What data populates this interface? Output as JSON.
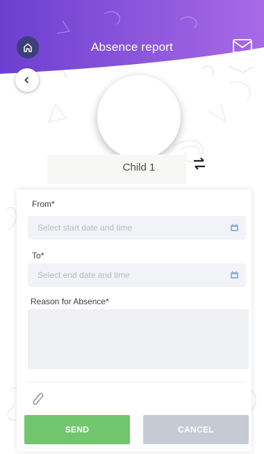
{
  "header": {
    "title": "Absence report",
    "gradient_left": "#6c3fd0",
    "gradient_right": "#a86ae6",
    "home_icon": "home-icon",
    "mail_icon": "mail-icon",
    "back_icon": "chevron-left-icon"
  },
  "profile": {
    "child_name": "Child 1",
    "switch_icon": "swap-arrows-icon"
  },
  "form": {
    "from_label": "From",
    "from_placeholder": "Select start date and time",
    "to_label": "To",
    "to_placeholder": "Select end date and time",
    "reason_label": "Reason for Absence",
    "required_mark": "*",
    "attach_icon": "paperclip-icon",
    "calendar_icon": "calendar-icon",
    "send_label": "SEND",
    "cancel_label": "CANCEL",
    "send_color": "#71c66e",
    "cancel_color": "#c5cad3",
    "field_placeholder_color": "#b7bac3"
  }
}
